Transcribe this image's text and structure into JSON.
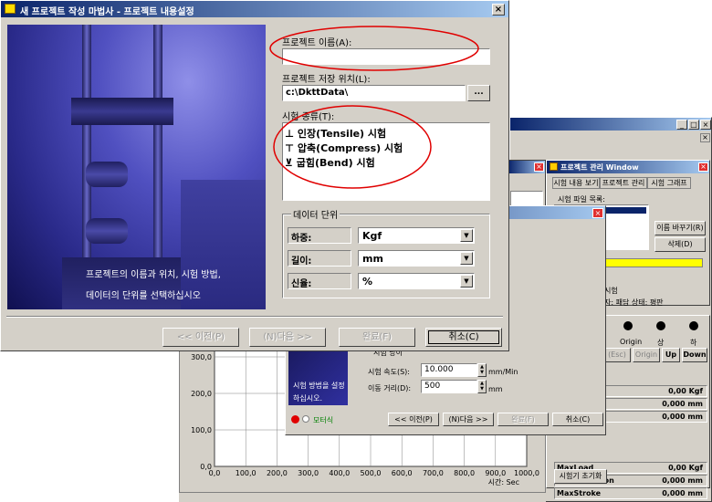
{
  "wizard": {
    "title": "새 프로젝트 작성 마법사 - 프로젝트 내용설정",
    "project_name_label": "프로젝트 이름(A):",
    "project_name_value": "",
    "save_location_label": "프로젝트 저장 위치(L):",
    "save_location_value": "c:\\DkttData\\",
    "browse_label": "...",
    "test_type_label": "시험 종류(T):",
    "test_types": [
      "인장(Tensile) 시험",
      "압축(Compress) 시험",
      "굽힘(Bend) 시험"
    ],
    "units_group_label": "데이터 단위",
    "load_label": "하중:",
    "load_value": "Kgf",
    "length_label": "길이:",
    "length_value": "mm",
    "elongation_label": "신율:",
    "elongation_value": "%",
    "instruction_line1": "프로젝트의 이름과 위치, 시험 방법,",
    "instruction_line2": "데이터의 단위를 선택하십시오",
    "back_button": "<< 이전(P)",
    "next_button": "(N)다음 >>",
    "finish_button": "완료(F)",
    "cancel_button": "취소(C)"
  },
  "main_app": {
    "project_window_title": "프로젝트 관리 Window",
    "tabs": [
      "시험 내용 보기",
      "프로젝트 관리",
      "시험 그래프"
    ],
    "file_list_label": "시험 파일 목록:",
    "rename_button": "이름 바꾸기(R)",
    "delete_button": "삭제(D)",
    "test_label": "시험",
    "info_text": "자: 패담  상태: 평판",
    "origin_label": "Origin",
    "up_label": "상",
    "down_label": "하",
    "esc_button": "(Esc)",
    "origin_button": "Origin",
    "up_button": "Up",
    "down_button": "Down",
    "readings": [
      {
        "label": "",
        "value": "0,00 Kgf"
      },
      {
        "label": "",
        "value": "0,000 mm"
      },
      {
        "label": "",
        "value": "0,000 mm"
      },
      {
        "label": "MaxLoad",
        "value": "0,00 Kgf"
      },
      {
        "label": "MaxExtension",
        "value": "0,000 mm"
      },
      {
        "label": "MaxStroke",
        "value": "0,000 mm"
      }
    ],
    "reset_button": "시험기 초기화"
  },
  "sub_dialog": {
    "test_speed_label": "시험 속도(S):",
    "test_speed_value": "10.000",
    "speed_unit": "mm/Min",
    "move_distance_label": "이동 거리(D):",
    "move_distance_value": "500",
    "distance_unit": "mm",
    "hint_line1": "시험 방법을 설정",
    "hint_line2": "하십시오.",
    "partial_label": "시험 방이",
    "motor_label": "모터식",
    "back_button": "<< 이전(P)",
    "next_button": "(N)다음 >>",
    "finish_button": "완료(F)",
    "cancel_button": "취소(C)"
  },
  "chart_data": {
    "type": "line",
    "y_ticks": [
      "300,0",
      "200,0",
      "100,0",
      "0,0"
    ],
    "x_ticks": [
      "0,0",
      "100,0",
      "200,0",
      "300,0",
      "400,0",
      "500,0",
      "600,0",
      "700,0",
      "800,0",
      "900,0",
      "1000,0"
    ],
    "xlabel": "시간: Sec",
    "series": []
  },
  "colors": {
    "titlebar": "#0a246a",
    "titlebar_end": "#a6caf0",
    "highlight": "#ffff00",
    "annotation": "#e00000"
  }
}
